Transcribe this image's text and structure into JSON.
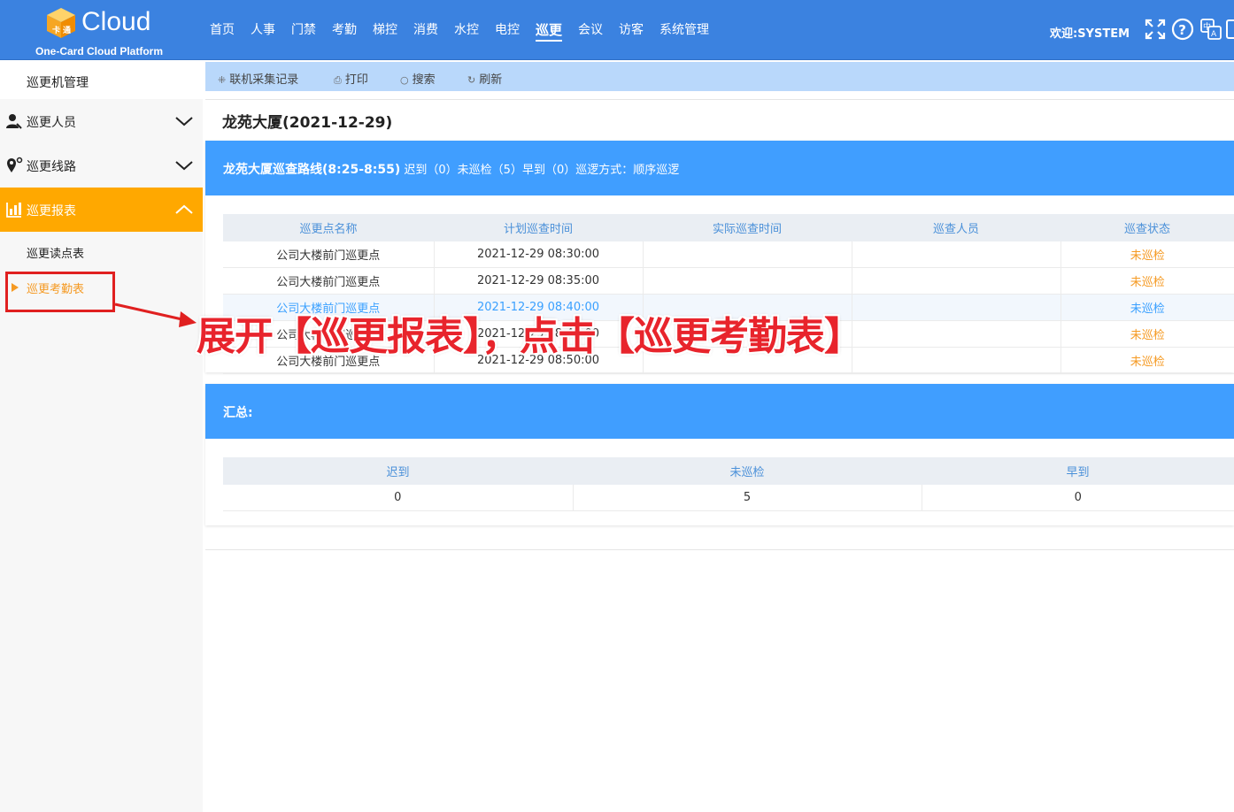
{
  "header": {
    "logo_word": "Cloud",
    "logo_sub": "One-Card Cloud Platform",
    "nav": [
      {
        "label": "首页",
        "active": false
      },
      {
        "label": "人事",
        "active": false
      },
      {
        "label": "门禁",
        "active": false
      },
      {
        "label": "考勤",
        "active": false
      },
      {
        "label": "梯控",
        "active": false
      },
      {
        "label": "消费",
        "active": false
      },
      {
        "label": "水控",
        "active": false
      },
      {
        "label": "电控",
        "active": false
      },
      {
        "label": "巡更",
        "active": true
      },
      {
        "label": "会议",
        "active": false
      },
      {
        "label": "访客",
        "active": false
      },
      {
        "label": "系统管理",
        "active": false
      }
    ],
    "welcome": "欢迎:SYSTEM",
    "icons": [
      "fullscreen-icon",
      "help-icon",
      "language-icon",
      "logout-icon"
    ]
  },
  "sidebar": {
    "top_item": "巡更机管理",
    "groups": [
      {
        "label": "巡更人员",
        "icon": "person-icon",
        "expanded": false
      },
      {
        "label": "巡更线路",
        "icon": "route-pin-icon",
        "expanded": false
      },
      {
        "label": "巡更报表",
        "icon": "bar-chart-icon",
        "expanded": true
      }
    ],
    "sub_items": [
      {
        "label": "巡更读点表",
        "active": false
      },
      {
        "label": "巡更考勤表",
        "active": true
      }
    ],
    "active_color": "#ffa800"
  },
  "toolbar": {
    "buttons": [
      {
        "label": "联机采集记录",
        "icon": "collect-icon"
      },
      {
        "label": "打印",
        "icon": "print-icon"
      },
      {
        "label": "搜索",
        "icon": "search-icon"
      },
      {
        "label": "刷新",
        "icon": "refresh-icon"
      }
    ]
  },
  "main": {
    "title": "龙苑大厦(2021-12-29)",
    "route_panel": {
      "route_name": "龙苑大厦巡查路线(8:25-8:55)",
      "summary_text": "迟到（0）未巡检（5）早到（0）巡逻方式：顺序巡逻"
    },
    "table": {
      "headers": [
        "巡更点名称",
        "计划巡查时间",
        "实际巡查时间",
        "巡查人员",
        "巡查状态"
      ],
      "rows": [
        {
          "point": "公司大楼前门巡更点",
          "planned": "2021-12-29 08:30:00",
          "actual": "",
          "person": "",
          "status": "未巡检",
          "highlight": false
        },
        {
          "point": "公司大楼前门巡更点",
          "planned": "2021-12-29 08:35:00",
          "actual": "",
          "person": "",
          "status": "未巡检",
          "highlight": false
        },
        {
          "point": "公司大楼前门巡更点",
          "planned": "2021-12-29 08:40:00",
          "actual": "",
          "person": "",
          "status": "未巡检",
          "highlight": true
        },
        {
          "point": "公司大楼前门巡更点",
          "planned": "2021-12-29 08:45:00",
          "actual": "",
          "person": "",
          "status": "未巡检",
          "highlight": false
        },
        {
          "point": "公司大楼前门巡更点",
          "planned": "2021-12-29 08:50:00",
          "actual": "",
          "person": "",
          "status": "未巡检",
          "highlight": false
        }
      ]
    },
    "summary_panel": {
      "title": "汇总:",
      "headers": [
        "迟到",
        "未巡检",
        "早到"
      ],
      "values": [
        "0",
        "5",
        "0"
      ]
    }
  },
  "annotation": {
    "text": "展开【巡更报表】，点击【巡更考勤表】",
    "color": "#e8242c"
  },
  "colors": {
    "header_blue": "#3b82e0",
    "panel_blue": "#409eff",
    "toolbar_blue": "#b9d8fb",
    "status_orange": "#f59a23"
  }
}
